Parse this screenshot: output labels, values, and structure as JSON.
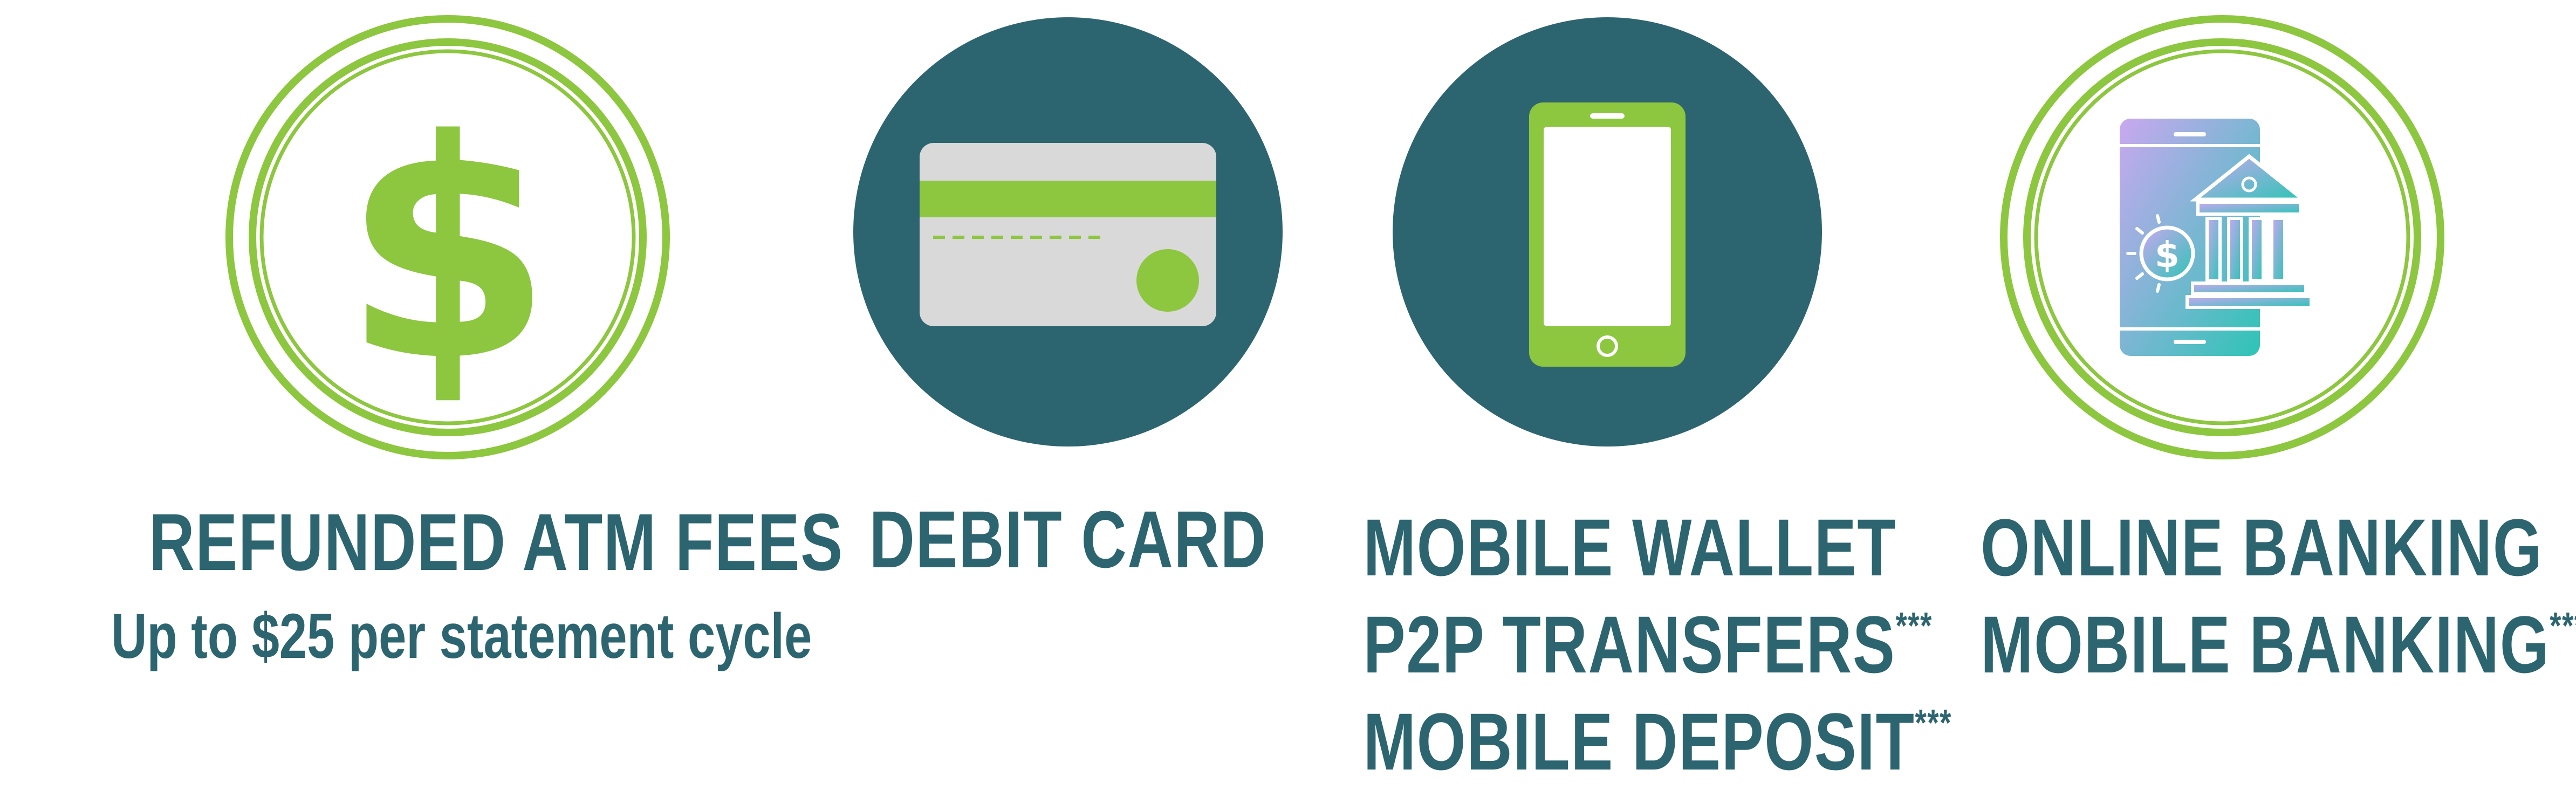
{
  "colors": {
    "teal": "#2c6570",
    "green": "#8dc63f",
    "card_gray": "#d9d9d9",
    "white": "#ffffff",
    "gradient_start": "#c9a8f0",
    "gradient_end": "#2ec4b6"
  },
  "features": [
    {
      "icon": "dollar-sign-icon",
      "title": "REFUNDED ATM FEES",
      "subtitle": "Up to $25 per statement cycle"
    },
    {
      "icon": "debit-card-icon",
      "title": "DEBIT CARD"
    },
    {
      "icon": "smartphone-icon",
      "lines": [
        "MOBILE WALLET",
        "P2P TRANSFERS",
        "MOBILE DEPOSIT"
      ],
      "marks": [
        "",
        "***",
        "***"
      ]
    },
    {
      "icon": "online-bank-icon",
      "lines": [
        "ONLINE BANKING",
        "MOBILE BANKING"
      ],
      "marks": [
        "",
        "***"
      ]
    }
  ]
}
